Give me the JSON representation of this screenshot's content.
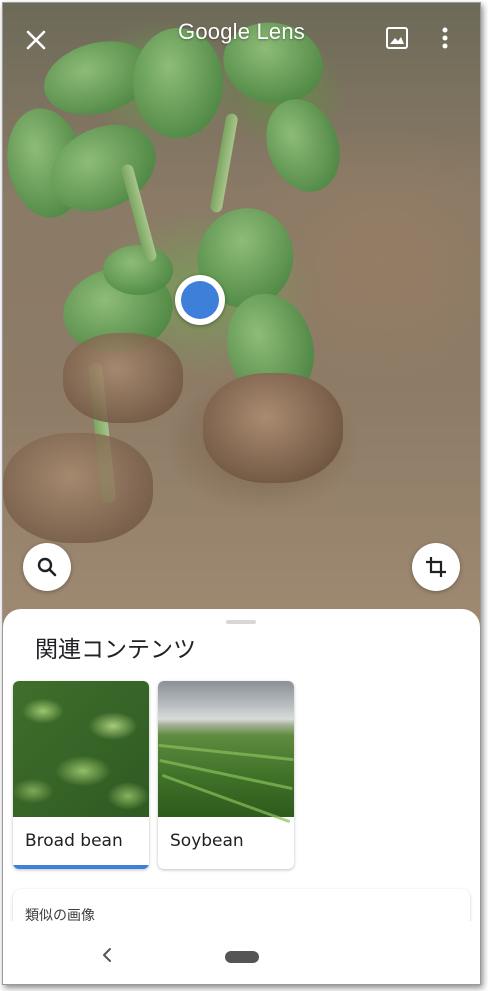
{
  "app": {
    "title": "Google Lens",
    "accent_color": "#3d7fd9"
  },
  "toolbar": {
    "close_icon": "close-icon",
    "gallery_icon": "image-gallery-icon",
    "more_icon": "more-vert-icon"
  },
  "camera": {
    "selection_marker": "blue-dot",
    "search_icon": "search-icon",
    "crop_icon": "crop-icon"
  },
  "sheet": {
    "title": "関連コンテンツ",
    "results": [
      {
        "label": "Broad bean",
        "selected": true
      },
      {
        "label": "Soybean",
        "selected": false
      }
    ],
    "similar_title": "類似の画像"
  },
  "navbar": {
    "back_icon": "chevron-left-icon",
    "home_icon": "home-pill"
  }
}
